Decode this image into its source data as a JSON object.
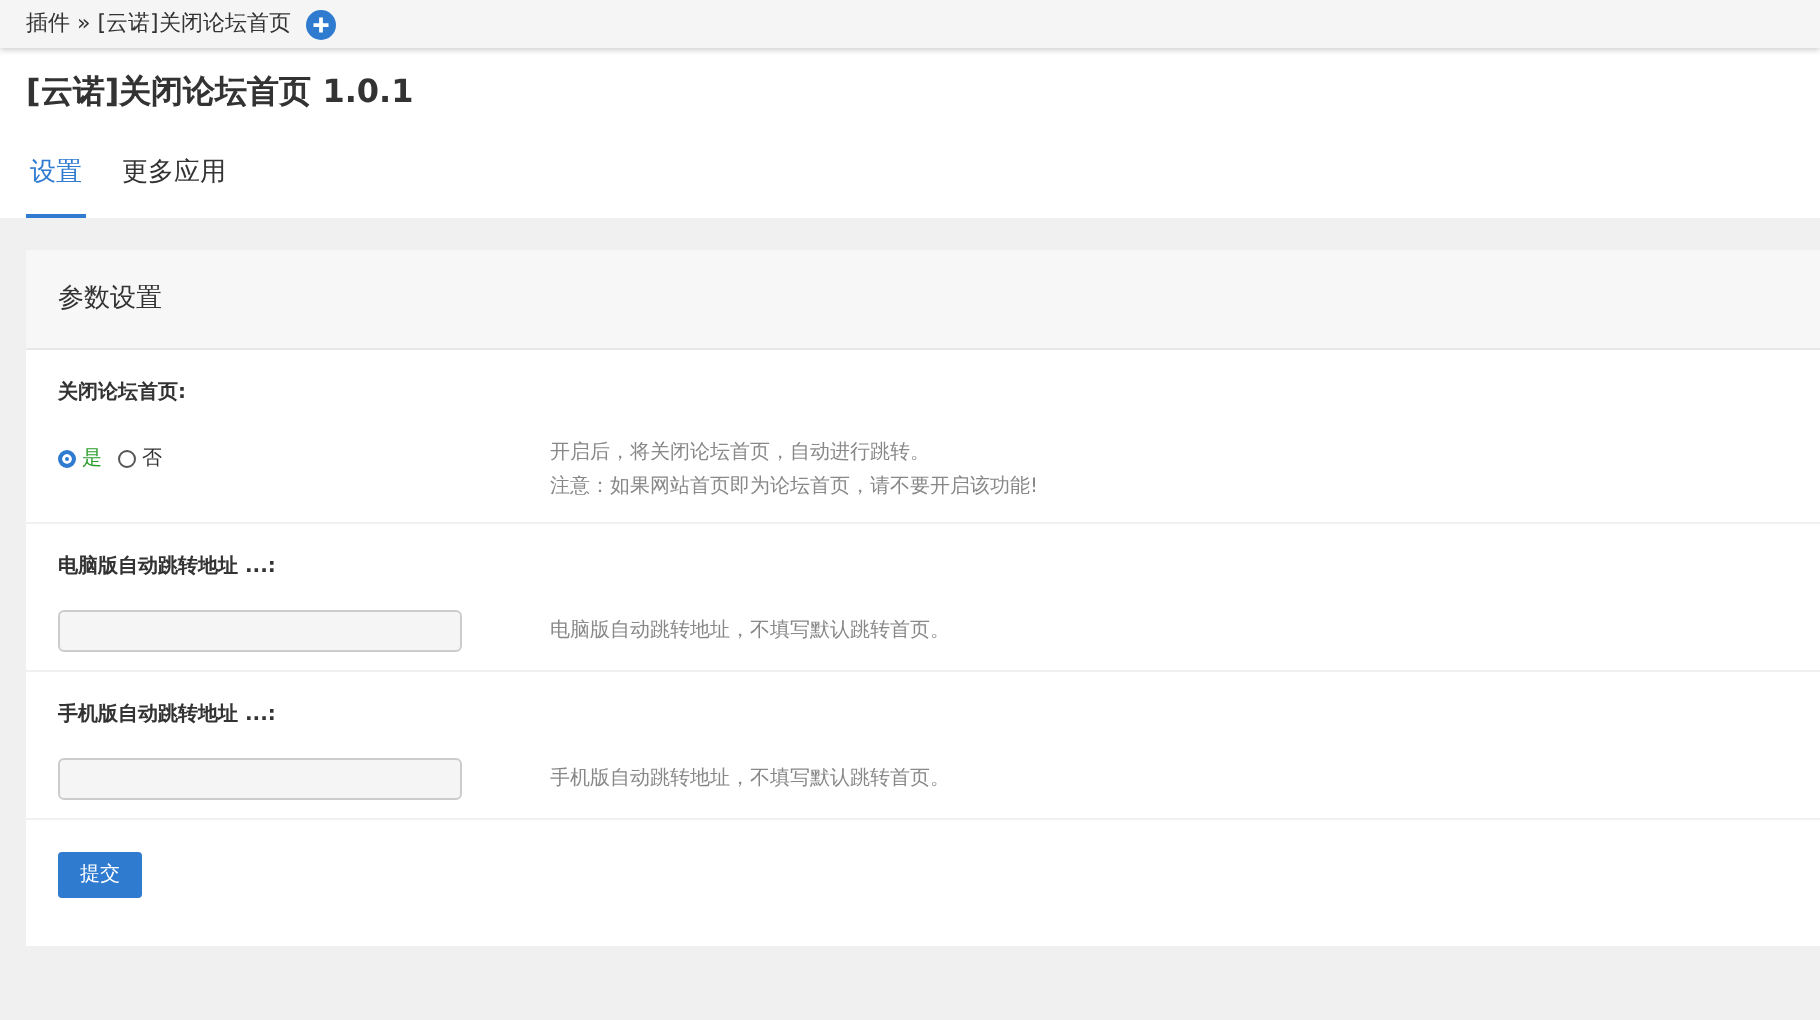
{
  "breadcrumb": {
    "items": [
      "插件",
      "[云诺]关闭论坛首页"
    ],
    "separator": "»"
  },
  "title": "[云诺]关闭论坛首页 1.0.1",
  "tabs": [
    {
      "label": "设置",
      "selected": true
    },
    {
      "label": "更多应用",
      "selected": false
    }
  ],
  "panel": {
    "title": "参数设置",
    "fields": [
      {
        "kind": "radio",
        "label": "关闭论坛首页:",
        "options": [
          {
            "label": "是",
            "selected": true
          },
          {
            "label": "否",
            "selected": false
          }
        ],
        "hint": [
          "开启后，将关闭论坛首页，自动进行跳转。",
          "注意：如果网站首页即为论坛首页，请不要开启该功能!"
        ]
      },
      {
        "kind": "text",
        "label": "电脑版自动跳转地址 ...:",
        "hint": [
          "电脑版自动跳转地址，不填写默认跳转首页。"
        ]
      },
      {
        "kind": "text",
        "label": "手机版自动跳转地址 ...:",
        "hint": [
          "手机版自动跳转地址，不填写默认跳转首页。"
        ]
      }
    ],
    "submit": "提交"
  }
}
